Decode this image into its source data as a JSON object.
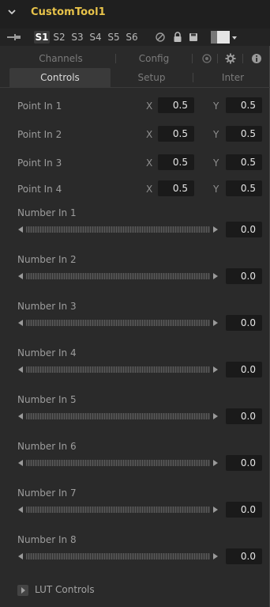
{
  "header": {
    "title": "CustomTool1"
  },
  "slots": [
    "S1",
    "S2",
    "S3",
    "S4",
    "S5",
    "S6"
  ],
  "active_slot": "S1",
  "tabs_row1": [
    "Channels",
    "Config",
    "",
    "",
    ""
  ],
  "tabs_row2": [
    "Controls",
    "Setup",
    "Inter"
  ],
  "active_tab": "Controls",
  "points": [
    {
      "label": "Point In 1",
      "x_axis": "X",
      "x": "0.5",
      "y_axis": "Y",
      "y": "0.5"
    },
    {
      "label": "Point In 2",
      "x_axis": "X",
      "x": "0.5",
      "y_axis": "Y",
      "y": "0.5"
    },
    {
      "label": "Point In 3",
      "x_axis": "X",
      "x": "0.5",
      "y_axis": "Y",
      "y": "0.5"
    },
    {
      "label": "Point In 4",
      "x_axis": "X",
      "x": "0.5",
      "y_axis": "Y",
      "y": "0.5"
    }
  ],
  "numbers": [
    {
      "label": "Number In 1",
      "value": "0.0"
    },
    {
      "label": "Number In 2",
      "value": "0.0"
    },
    {
      "label": "Number In 3",
      "value": "0.0"
    },
    {
      "label": "Number In 4",
      "value": "0.0"
    },
    {
      "label": "Number In 5",
      "value": "0.0"
    },
    {
      "label": "Number In 6",
      "value": "0.0"
    },
    {
      "label": "Number In 7",
      "value": "0.0"
    },
    {
      "label": "Number In 8",
      "value": "0.0"
    }
  ],
  "lut": {
    "label": "LUT Controls"
  },
  "colors": {
    "title": "#e8c34a",
    "panel": "#2a2a2a",
    "field": "#1a1a1a"
  },
  "icons": [
    "chevron-down-icon",
    "pin-icon",
    "no-entry-icon",
    "lock-icon",
    "save-icon",
    "color-swatch-icon",
    "dropdown-arrow-icon",
    "camera-icon",
    "gear-icon",
    "info-icon",
    "slider-left-arrow-icon",
    "slider-right-arrow-icon",
    "expand-arrow-icon"
  ]
}
